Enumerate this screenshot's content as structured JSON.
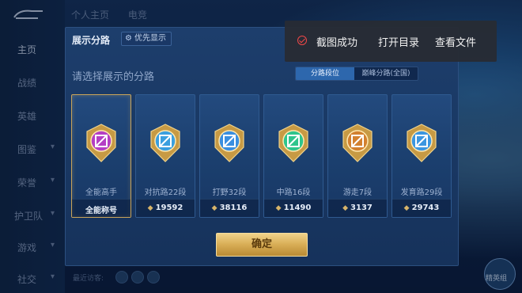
{
  "sidebar": {
    "items": [
      {
        "label": "主页",
        "active": true,
        "has_arrow": false
      },
      {
        "label": "战绩",
        "active": false,
        "has_arrow": false
      },
      {
        "label": "英雄",
        "active": false,
        "has_arrow": false
      },
      {
        "label": "图鉴",
        "active": false,
        "has_arrow": true
      },
      {
        "label": "荣誉",
        "active": false,
        "has_arrow": true
      },
      {
        "label": "护卫队",
        "active": false,
        "has_arrow": true
      },
      {
        "label": "游戏",
        "active": false,
        "has_arrow": true
      },
      {
        "label": "社交",
        "active": false,
        "has_arrow": true
      }
    ]
  },
  "top_tabs": [
    "个人主页",
    "电竞"
  ],
  "dialog": {
    "title": "展示分路",
    "priority_button": "优先显示",
    "subtitle": "请选择展示的分路",
    "segments": [
      "分路段位",
      "巅峰分路(全国)"
    ],
    "confirm_label": "确定",
    "cards": [
      {
        "name": "全能高手",
        "value": "全能称号",
        "selected": true,
        "emblem": "all-round-emblem-icon",
        "color": "#b43fc4"
      },
      {
        "name": "对抗路22段",
        "value": "19592",
        "selected": false,
        "emblem": "clash-lane-emblem-icon",
        "color": "#3a9fdf"
      },
      {
        "name": "打野32段",
        "value": "38116",
        "selected": false,
        "emblem": "jungle-emblem-icon",
        "color": "#3a8fe0"
      },
      {
        "name": "中路16段",
        "value": "11490",
        "selected": false,
        "emblem": "mid-lane-emblem-icon",
        "color": "#2ec58c"
      },
      {
        "name": "游走7段",
        "value": "3137",
        "selected": false,
        "emblem": "roam-emblem-icon",
        "color": "#d2802f"
      },
      {
        "name": "发育路29段",
        "value": "29743",
        "selected": false,
        "emblem": "farm-lane-emblem-icon",
        "color": "#3c96e0"
      }
    ]
  },
  "toast": {
    "status": "截图成功",
    "open_dir": "打开目录",
    "view_file": "查看文件"
  },
  "bottom": {
    "text": "最近访客:"
  },
  "corner": {
    "label": "精英组"
  },
  "colors": {
    "accent_gold": "#d8ad55",
    "panel": "#1d3e6c",
    "toast_ok": "#f04848"
  }
}
